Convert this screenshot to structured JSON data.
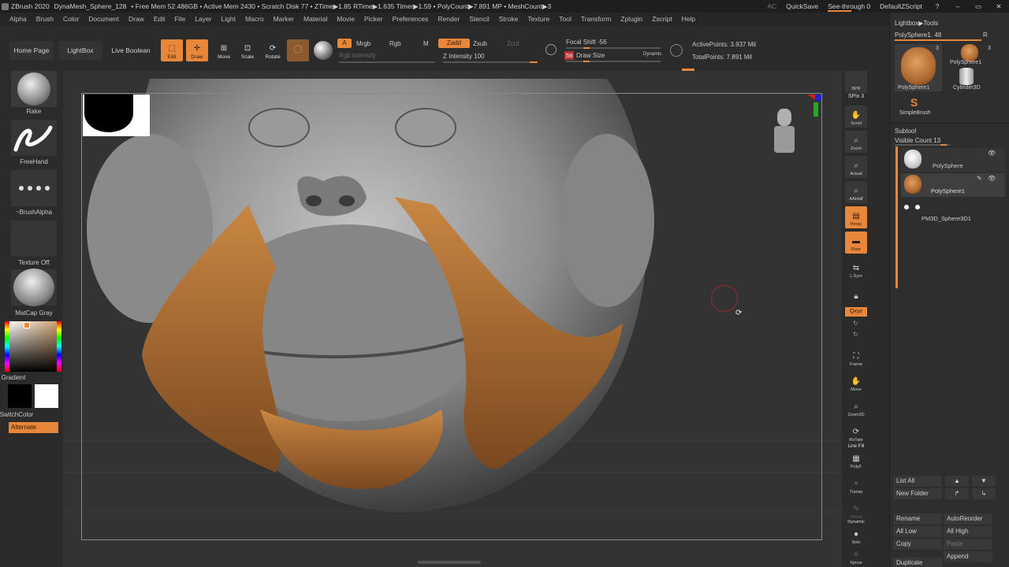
{
  "titlebar": {
    "items": [
      "ZBrush 2020",
      "DynaMesh_Sphere_128",
      "• Free Mem 52.486GB • Active Mem 2430 • Scratch Disk 77 • ZTime▶1.85 RTime▶1.635 Timer▶1.59 • PolyCount▶7.891 MP • MeshCount▶3"
    ],
    "ac": "AC",
    "quicksave": "QuickSave",
    "see_through": "See-through  0",
    "default_zscript": "DefaultZScript",
    "win_buttons": [
      "?",
      "–",
      "▭",
      "✕"
    ]
  },
  "menubar": {
    "items": [
      "Alpha",
      "Brush",
      "Color",
      "Document",
      "Draw",
      "Edit",
      "File",
      "Layer",
      "Light",
      "Macro",
      "Marker",
      "Material",
      "Movie",
      "Picker",
      "Preferences",
      "Render",
      "Stencil",
      "Stroke",
      "Texture",
      "Tool",
      "Transform",
      "Zplugin",
      "Zscript",
      "Help"
    ]
  },
  "toolbar": {
    "home_page": "Home Page",
    "lightbox": "LightBox",
    "live_boolean": "Live Boolean",
    "edit": "Edit",
    "draw": "Draw",
    "move": "Move",
    "scale": "Scale",
    "rotate": "Rotate",
    "a_tag": "A",
    "mrgb": "Mrgb",
    "rgb": "Rgb",
    "m": "M",
    "zadd": "Zadd",
    "zsub": "Zsub",
    "zcut": "Zcut",
    "rgb_intensity": "Rgb Intensity",
    "z_intensity": "Z Intensity 100",
    "focal_shift": "Focal Shift -56",
    "draw_size_value": "59",
    "draw_size_label": "Draw Size",
    "dynamic": "Dynamic",
    "active_points": "ActivePoints: 3.937 Mil",
    "total_points": "TotalPoints: 7.891 Mil"
  },
  "leftpanel": {
    "rake": "Rake",
    "freehand": "FreeHand",
    "brush_alpha": "~BrushAlpha",
    "texture_off": "Texture Off",
    "matcap": "MatCap Gray",
    "gradient": "Gradient",
    "switch_color": "SwitchColor",
    "alternate": "Alternate"
  },
  "rightshelf": {
    "bpr": "BPR",
    "spix": "SPix 3",
    "scroll": "Scroll",
    "zoom": "Zoom",
    "actual": "Actual",
    "aahalf": "AAHalf",
    "persp": "Persp",
    "floor": "Floor",
    "lsym": "L.Sym",
    "lock": "",
    "qxyz": "Qxyz",
    "frame": "Frame",
    "move": "Move",
    "zoom3d": "Zoom3D",
    "rotate": "RoTate",
    "line_fill": "Line Fill",
    "polyf": "PolyF",
    "transp": "Transp",
    "ghost": "Ghost",
    "dynamic": "Dynamic",
    "solo": "Solo",
    "xpose": "Xpose"
  },
  "tray": {
    "lightbox_tools": "Lightbox▶Tools",
    "polysphere_count": "PolySphere1. 48",
    "r": "R",
    "thumb1_label": "PolySphere1",
    "thumb1_count": "3",
    "thumb2_label": "PolySphere1",
    "thumb2_count": "3",
    "cylinder": "Cylinder3D",
    "simplebrush": "SimpleBrush",
    "subtool": "Subtool",
    "visible_count": "Visible Count 13",
    "subtools": [
      "PolySphere",
      "PolySphere1",
      "PM3D_Sphere3D1"
    ],
    "list_all": "List All",
    "new_folder": "New Folder",
    "rename": "Rename",
    "autoreorder": "AutoReorder",
    "all_low": "All Low",
    "all_high": "All High",
    "copy": "Copy",
    "paste": "Paste",
    "duplicate": "Duplicate",
    "append": "Append"
  },
  "colors": {
    "accent": "#e8873a",
    "background": "#2b2b2b",
    "mesh_gray": "#9a9a9a",
    "fur_orange": "#c07a3a"
  }
}
